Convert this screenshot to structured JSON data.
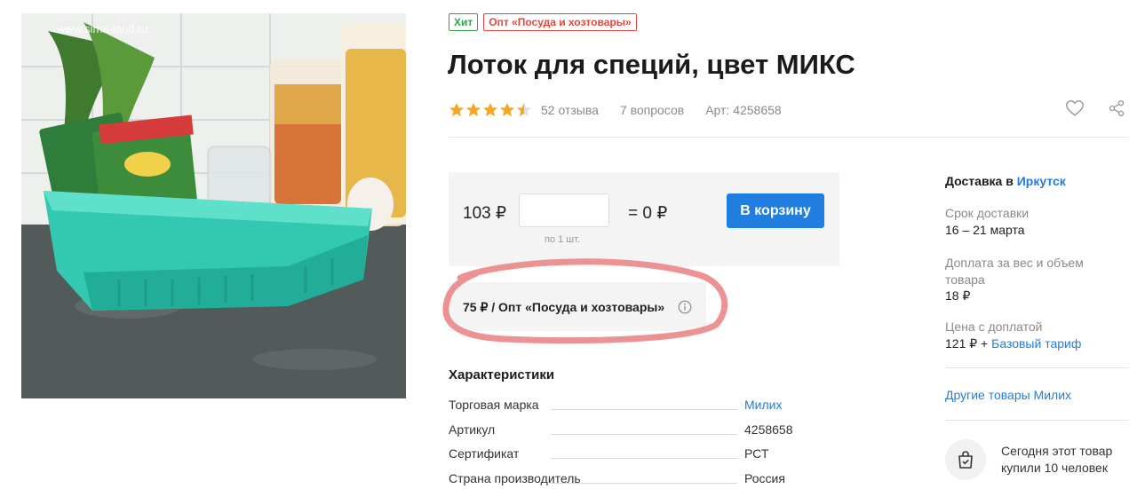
{
  "image": {
    "watermark": "www.sima-land.ru"
  },
  "badges": {
    "hit": "Хит",
    "opt": "Опт «Посуда и хозтовары»"
  },
  "product": {
    "title": "Лоток для специй, цвет МИКС",
    "rating": 4.5,
    "reviews": "52 отзыва",
    "questions": "7 вопросов",
    "article": "Арт: 4258658"
  },
  "buy": {
    "price": "103 ₽",
    "quantity_value": "",
    "per_unit": "по 1 шт.",
    "total": "= 0 ₽",
    "cart_button": "В корзину"
  },
  "wholesale": {
    "text": "75 ₽ / Опт «Посуда и хозтовары»"
  },
  "characteristics": {
    "title": "Характеристики",
    "rows": [
      {
        "key": "Торговая марка",
        "value": "Милих"
      },
      {
        "key": "Артикул",
        "value": "4258658"
      },
      {
        "key": "Сертификат",
        "value": "РСТ"
      },
      {
        "key": "Страна производитель",
        "value": "Россия"
      }
    ]
  },
  "delivery": {
    "title_prefix": "Доставка в",
    "city": "Иркутск",
    "term_label": "Срок доставки",
    "term_value": "16 – 21 марта",
    "surcharge_label": "Доплата за вес и объем товара",
    "surcharge_value": "18 ₽",
    "price_with_label": "Цена с доплатой",
    "price_with_value": "121 ₽ + ",
    "tariff_link": "Базовый тариф",
    "other_goods": "Другие товары Милих",
    "bought_today": "Сегодня этот товар купили 10 человек"
  },
  "colors": {
    "accent": "#1f7ee0",
    "hit": "#2ea34a",
    "opt": "#e8453c",
    "star": "#f5a623",
    "annotation": "#ec8c8c"
  },
  "icons": [
    "star-icon",
    "heart-icon",
    "share-icon",
    "info-icon",
    "shopping-bag-icon"
  ]
}
